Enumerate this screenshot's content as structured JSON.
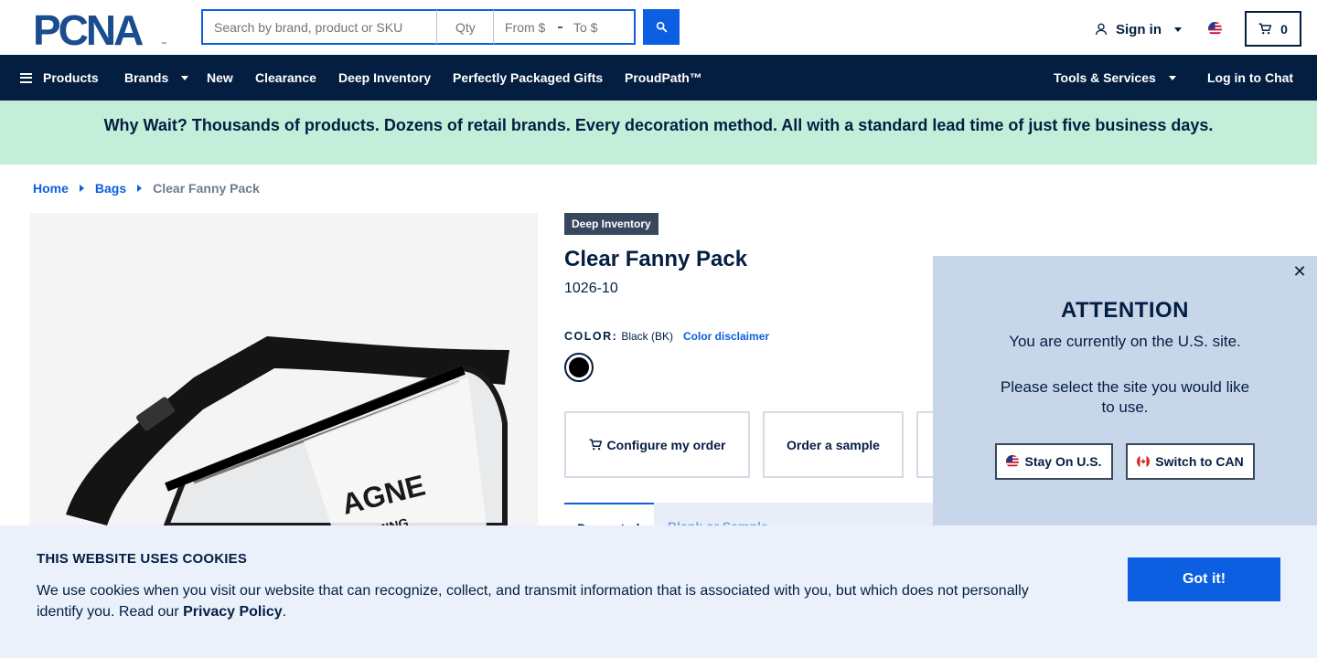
{
  "brand": {
    "logo_text": "PCNA"
  },
  "search": {
    "placeholder": "Search by brand, product or SKU",
    "qty_placeholder": "Qty",
    "from_placeholder": "From $",
    "to_placeholder": "To $"
  },
  "account": {
    "sign_in_label": "Sign in"
  },
  "cart": {
    "count": "0"
  },
  "nav": {
    "products": "Products",
    "brands": "Brands",
    "new": "New",
    "clearance": "Clearance",
    "deep_inventory": "Deep Inventory",
    "gifts": "Perfectly Packaged Gifts",
    "proudpath": "ProudPath™",
    "tools": "Tools & Services",
    "chat": "Log in to Chat"
  },
  "promo": {
    "text": "Why Wait? Thousands of products. Dozens of retail brands. Every decoration method. All with a standard lead time of just five business days."
  },
  "breadcrumb": {
    "home": "Home",
    "category": "Bags",
    "current": "Clear Fanny Pack"
  },
  "product": {
    "tag": "Deep Inventory",
    "title": "Clear Fanny Pack",
    "sku": "1026-10",
    "color_label": "COLOR:",
    "color_value": "Black (BK)",
    "color_disclaimer": "Color disclaimer",
    "image_print": "AGNE",
    "image_print_sub": "MING",
    "configure_label": "Configure my order",
    "sample_label": "Order a sample",
    "tab_active": "Decorated",
    "tab_inactive": "Blank or Sample"
  },
  "attention": {
    "title": "ATTENTION",
    "line1": "You are currently on the U.S. site.",
    "line2": "Please select the site you would like to use.",
    "stay_label": "Stay On U.S.",
    "switch_label": "Switch to CAN"
  },
  "cookies": {
    "title": "THIS WEBSITE USES COOKIES",
    "text": "We use cookies when you visit our website that can recognize, collect, and transmit information that is associated with you, but which does not personally identify you. Read our ",
    "policy_link": "Privacy Policy",
    "period": ".",
    "button": "Got it!"
  },
  "colors": {
    "navy": "#041e42",
    "accent_blue": "#0b5fe0",
    "promo_bg": "#c3eed9",
    "attention_bg": "#c8d6ea",
    "cookie_bg": "#eaf1fb"
  }
}
